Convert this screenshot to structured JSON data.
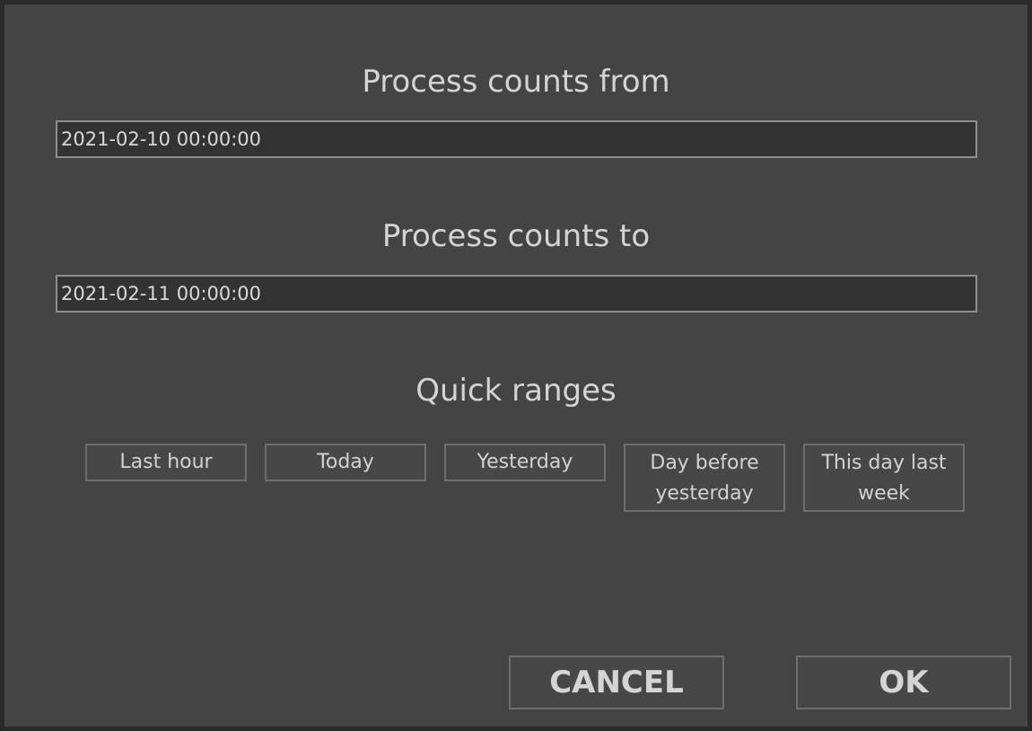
{
  "dialog": {
    "from_label": "Process counts from",
    "from_value": "2021-02-10 00:00:00",
    "to_label": "Process counts to",
    "to_value": "2021-02-11 00:00:00",
    "quick_label": "Quick ranges",
    "quick_ranges": [
      "Last hour",
      "Today",
      "Yesterday",
      "Day before yesterday",
      "This day last week"
    ],
    "cancel_label": "CANCEL",
    "ok_label": "OK"
  },
  "colors": {
    "dialog_bg": "#444444",
    "field_bg": "#333333",
    "button_bg": "#474747",
    "text": "#d6d6d6"
  }
}
